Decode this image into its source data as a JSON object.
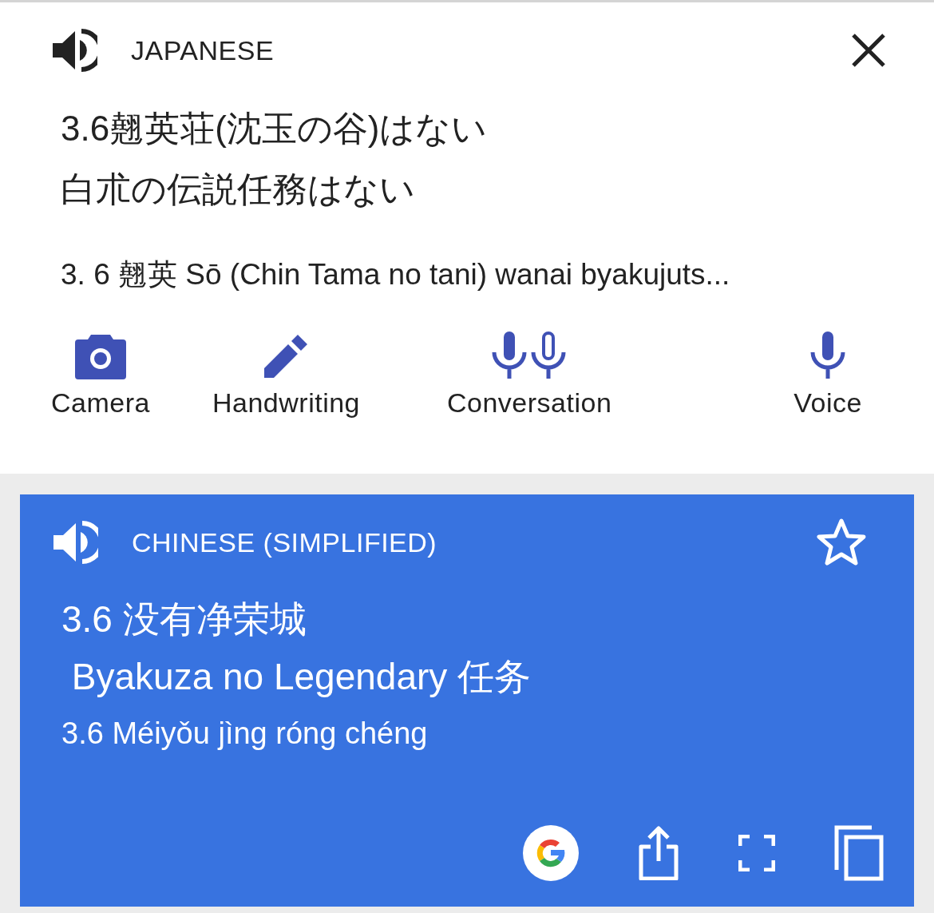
{
  "source": {
    "language": "JAPANESE",
    "lines": [
      "3.6翹英荘(沈玉の谷)はない",
      "白朮の伝説任務はない"
    ],
    "romanization": "3. 6 翹英 Sō (Chin Tama no tani) wanai byakujuts..."
  },
  "input_modes": [
    {
      "kind": "camera",
      "label": "Camera"
    },
    {
      "kind": "handwriting",
      "label": "Handwriting"
    },
    {
      "kind": "conversation",
      "label": "Conversation"
    },
    {
      "kind": "voice",
      "label": "Voice"
    }
  ],
  "translation": {
    "language": "CHINESE (SIMPLIFIED)",
    "starred": false,
    "lines": [
      "3.6 没有净荣城",
      " Byakuza no Legendary 任务"
    ],
    "romanization": "3.6 Méiyǒu jìng róng chéng"
  }
}
